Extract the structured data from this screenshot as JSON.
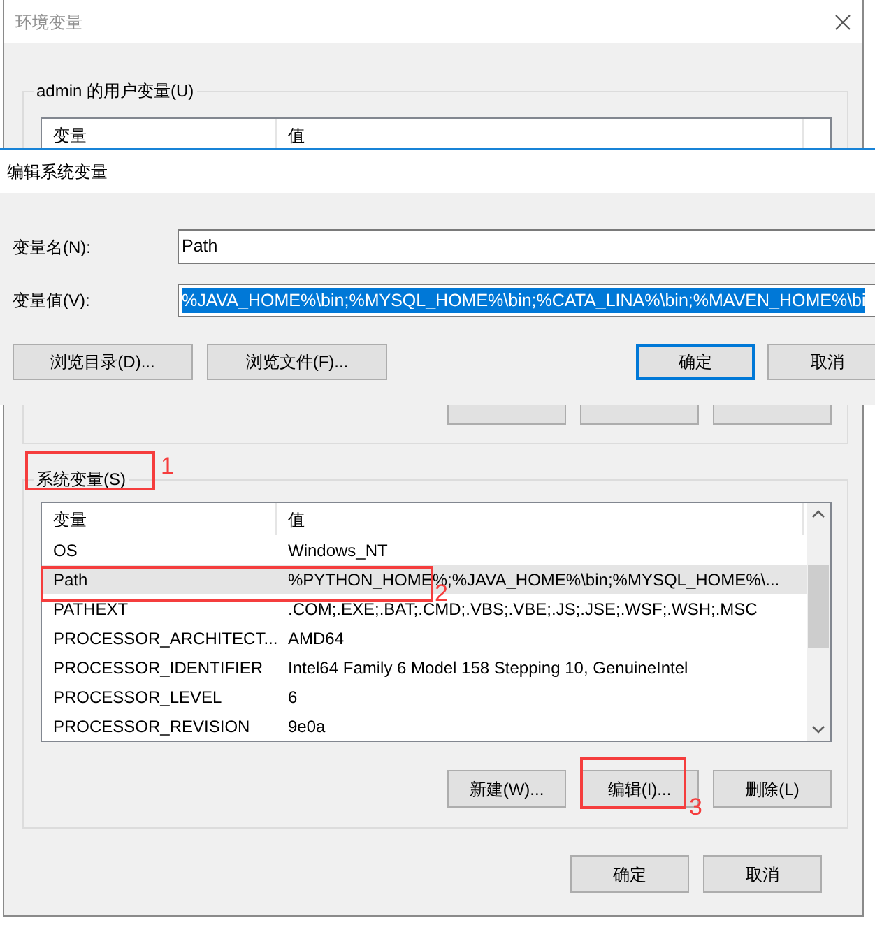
{
  "main_window": {
    "title": "环境变量",
    "user_variables": {
      "label": "admin 的用户变量(U)",
      "columns": [
        "变量",
        "值"
      ]
    },
    "system_variables": {
      "label": "系统变量(S)",
      "annotation": "1",
      "columns": [
        "变量",
        "值"
      ],
      "rows": [
        {
          "variable": "OS",
          "value": "Windows_NT",
          "selected": false
        },
        {
          "variable": "Path",
          "value": "%PYTHON_HOME%;%JAVA_HOME%\\bin;%MYSQL_HOME%\\...",
          "selected": true,
          "annotation": "2"
        },
        {
          "variable": "PATHEXT",
          "value": ".COM;.EXE;.BAT;.CMD;.VBS;.VBE;.JS;.JSE;.WSF;.WSH;.MSC",
          "selected": false
        },
        {
          "variable": "PROCESSOR_ARCHITECT...",
          "value": "AMD64",
          "selected": false
        },
        {
          "variable": "PROCESSOR_IDENTIFIER",
          "value": "Intel64 Family 6 Model 158 Stepping 10, GenuineIntel",
          "selected": false
        },
        {
          "variable": "PROCESSOR_LEVEL",
          "value": "6",
          "selected": false
        },
        {
          "variable": "PROCESSOR_REVISION",
          "value": "9e0a",
          "selected": false
        }
      ],
      "buttons": [
        {
          "label": "新建(W)..."
        },
        {
          "label": "编辑(I)...",
          "annotation": "3"
        },
        {
          "label": "删除(L)"
        }
      ]
    },
    "buttons": [
      {
        "label": "确定"
      },
      {
        "label": "取消"
      }
    ]
  },
  "edit_dialog": {
    "title": "编辑系统变量",
    "fields": [
      {
        "label": "变量名(N):",
        "value": "Path",
        "selected": false
      },
      {
        "label": "变量值(V):",
        "value": "%JAVA_HOME%\\bin;%MYSQL_HOME%\\bin;%CATA_LINA%\\bin;%MAVEN_HOME%\\bi",
        "selected": true
      }
    ],
    "browse_buttons": [
      {
        "label": "浏览目录(D)..."
      },
      {
        "label": "浏览文件(F)..."
      }
    ],
    "buttons": [
      {
        "label": "确定",
        "default": true
      },
      {
        "label": "取消",
        "default": false
      }
    ]
  }
}
